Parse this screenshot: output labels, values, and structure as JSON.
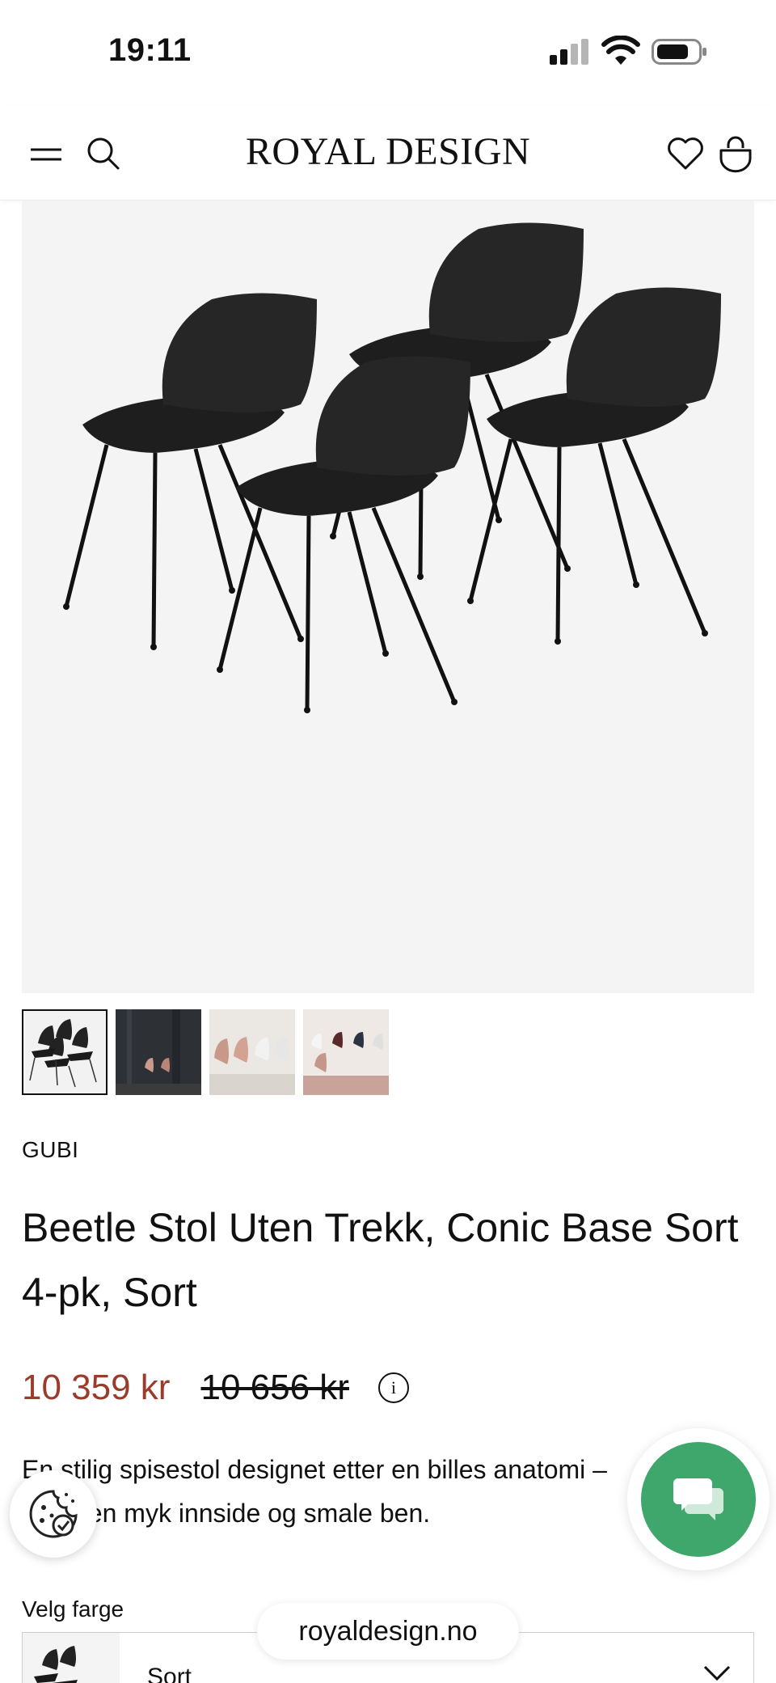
{
  "status_bar": {
    "time": "19:11"
  },
  "header": {
    "logo": "ROYAL DESIGN",
    "menu_icon": "menu-icon",
    "search_icon": "search-icon",
    "wishlist_icon": "heart-icon",
    "cart_icon": "shopping-bag-icon"
  },
  "gallery": {
    "thumbnails": [
      "thumb-1",
      "thumb-2",
      "thumb-3",
      "thumb-4"
    ],
    "active_index": 0
  },
  "product": {
    "brand": "GUBI",
    "title": "Beetle Stol Uten Trekk, Conic Base Sort 4-pk, Sort",
    "price_sale": "10 359 kr",
    "price_original": "10 656 kr",
    "description": "En stilig spisestol designet etter en billes anatomi – skall, en myk innside og smale ben."
  },
  "color_picker": {
    "label": "Velg farge",
    "selected": "Sort"
  },
  "browser": {
    "url": "royaldesign.no"
  },
  "colors": {
    "price_sale": "#9b3b2c",
    "chat": "#3fa76b"
  }
}
